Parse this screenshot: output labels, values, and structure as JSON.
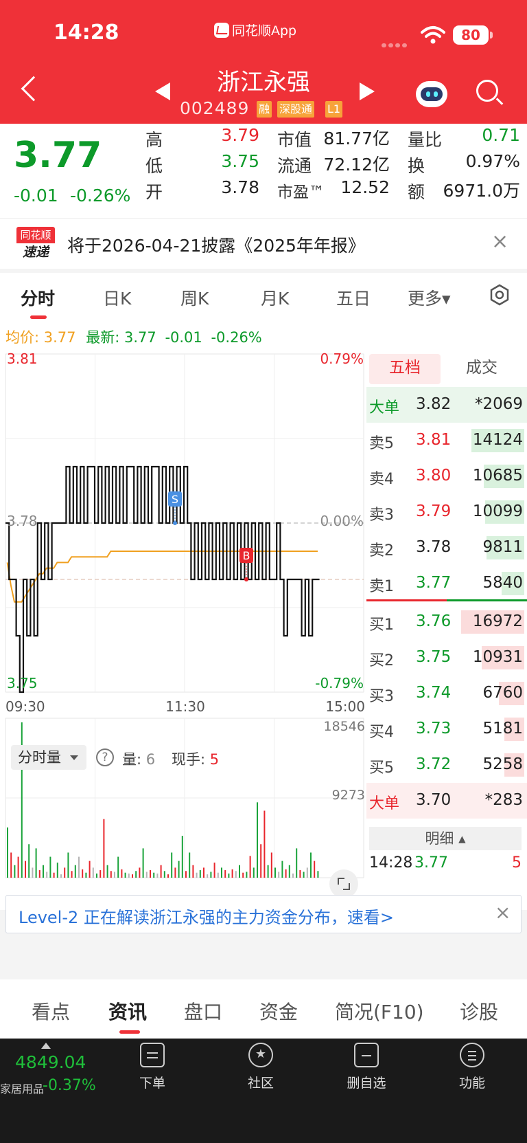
{
  "status_bar": {
    "time": "14:28",
    "app_name": "同花顺App",
    "battery": "80"
  },
  "header": {
    "stock_name": "浙江永强",
    "stock_code": "002489",
    "tags": [
      "融",
      "深股通",
      "L1"
    ]
  },
  "quote": {
    "price": "3.77",
    "change": "-0.01",
    "change_pct": "-0.26%",
    "fields": {
      "high_label": "高",
      "high": "3.79",
      "low_label": "低",
      "low": "3.75",
      "open_label": "开",
      "open": "3.78",
      "mktcap_label": "市值",
      "mktcap": "81.77亿",
      "float_label": "流通",
      "float": "72.12亿",
      "pe_label": "市盈™",
      "pe": "12.52",
      "vr_label": "量比",
      "vr": "0.71",
      "turnover_label": "换",
      "turnover": "0.97%",
      "amount_label": "额",
      "amount": "6971.0万"
    }
  },
  "notice": {
    "logo_top": "同花顺",
    "logo_bottom": "速递",
    "text": "将于2026-04-21披露《2025年年报》",
    "close": "×"
  },
  "chart_tabs": [
    "分时",
    "日K",
    "周K",
    "月K",
    "五日",
    "更多▾"
  ],
  "indicator_line": {
    "avg_label": "均价:",
    "avg": "3.77",
    "latest_label": "最新:",
    "latest": "3.77",
    "change": "-0.01",
    "change_pct": "-0.26%"
  },
  "chart_data": {
    "type": "line",
    "title": "",
    "x_ticks": [
      "09:30",
      "11:30",
      "15:00"
    ],
    "price_axis": {
      "max": "3.81",
      "mid": "3.78",
      "min": "3.75",
      "max_pct": "0.79%",
      "mid_pct": "0.00%",
      "min_pct": "-0.79%"
    },
    "ylim": [
      3.75,
      3.81
    ],
    "series": [
      {
        "name": "",
        "color": "#000000",
        "values": [
          3.78,
          3.77,
          3.77,
          3.76,
          3.75,
          3.77,
          3.76,
          3.77,
          3.76,
          3.78,
          3.77,
          3.78,
          3.77,
          3.78,
          3.78,
          3.78,
          3.78,
          3.79,
          3.78,
          3.79,
          3.78,
          3.79,
          3.78,
          3.79,
          3.79,
          3.78,
          3.79,
          3.78,
          3.79,
          3.78,
          3.79,
          3.78,
          3.79,
          3.78,
          3.79,
          3.79,
          3.78,
          3.79,
          3.78,
          3.79,
          3.78,
          3.79,
          3.79,
          3.78,
          3.79,
          3.78,
          3.79,
          3.78,
          3.79,
          3.78,
          3.79,
          3.78,
          3.77,
          3.78,
          3.77,
          3.78,
          3.77,
          3.78,
          3.77,
          3.78,
          3.77,
          3.78,
          3.77,
          3.78,
          3.77,
          3.78,
          3.77,
          3.78,
          3.77,
          3.78,
          3.77,
          3.78,
          3.77,
          3.78,
          3.77,
          3.77,
          3.78,
          3.77,
          3.76,
          3.77,
          3.77,
          3.77,
          3.77,
          3.76,
          3.77,
          3.76,
          3.77,
          3.77
        ]
      },
      {
        "name": "",
        "color": "#f0a020",
        "values": [
          3.773,
          3.769,
          3.766,
          3.766,
          3.766,
          3.767,
          3.768,
          3.769,
          3.77,
          3.771,
          3.771,
          3.772,
          3.772,
          3.772,
          3.773,
          3.773,
          3.773,
          3.773,
          3.774,
          3.774,
          3.774,
          3.774,
          3.774,
          3.774,
          3.774,
          3.774,
          3.774,
          3.774,
          3.774,
          3.775,
          3.775,
          3.775,
          3.775,
          3.775,
          3.775,
          3.775,
          3.775,
          3.775,
          3.775,
          3.775,
          3.775,
          3.775,
          3.775,
          3.775,
          3.775,
          3.775,
          3.775,
          3.775,
          3.775,
          3.775,
          3.775,
          3.775,
          3.775,
          3.775,
          3.775,
          3.775,
          3.775,
          3.775,
          3.775,
          3.775,
          3.775,
          3.775,
          3.775,
          3.775,
          3.775,
          3.775,
          3.775,
          3.775,
          3.775,
          3.775,
          3.775,
          3.775,
          3.775,
          3.775,
          3.775,
          3.775,
          3.775,
          3.775,
          3.775,
          3.775,
          3.775,
          3.775,
          3.775,
          3.775,
          3.775,
          3.775,
          3.775,
          3.775
        ]
      }
    ],
    "markers": [
      {
        "label": "S",
        "index": 47,
        "value": 3.78,
        "color": "#4a90e2"
      },
      {
        "label": "B",
        "index": 67,
        "value": 3.77,
        "color": "#e8262d"
      }
    ],
    "volume": {
      "ticks": [
        "18546",
        "9273"
      ],
      "ymax": 18546,
      "values": [
        6000,
        3000,
        1500,
        2500,
        18546,
        2000,
        4000,
        1200,
        3500,
        900,
        1500,
        700,
        2500,
        600,
        1800,
        400,
        1200,
        3000,
        800,
        1500,
        2500,
        1000,
        600,
        2000,
        1200,
        500,
        900,
        7000,
        1500,
        800,
        700,
        2500,
        1000,
        600,
        500,
        400,
        800,
        1200,
        3500,
        700,
        900,
        600,
        500,
        1500,
        800,
        400,
        3000,
        1200,
        2000,
        5000,
        800,
        3000,
        1500,
        600,
        900,
        1200,
        400,
        700,
        1800,
        600,
        1200,
        900,
        500,
        1000,
        800,
        1500,
        600,
        700,
        2600,
        1200,
        9000,
        4000,
        8000,
        1500,
        3000,
        1200,
        700,
        2000,
        1000,
        1500,
        500,
        3500,
        900,
        700,
        1200,
        3000,
        2000,
        800
      ],
      "colors": [
        "g",
        "r",
        "g",
        "r",
        "g",
        "r",
        "g",
        "gray",
        "g",
        "r",
        "g",
        "gray",
        "g",
        "r",
        "g",
        "gray",
        "r",
        "g",
        "r",
        "g",
        "gray",
        "r",
        "g",
        "r",
        "gray",
        "g",
        "r",
        "r",
        "g",
        "r",
        "gray",
        "g",
        "r",
        "g",
        "gray",
        "r",
        "g",
        "r",
        "g",
        "gray",
        "r",
        "g",
        "gray",
        "r",
        "g",
        "r",
        "g",
        "r",
        "g",
        "g",
        "r",
        "g",
        "r",
        "gray",
        "g",
        "r",
        "gray",
        "g",
        "r",
        "gray",
        "g",
        "r",
        "g",
        "r",
        "gray",
        "g",
        "r",
        "g",
        "r",
        "g",
        "g",
        "r",
        "r",
        "g",
        "r",
        "g",
        "gray",
        "g",
        "r",
        "g",
        "gray",
        "g",
        "r",
        "g",
        "gray",
        "g",
        "r",
        "g"
      ],
      "dropdown_label": "分时量",
      "vol_label": "量:",
      "vol_value": "6",
      "now_label": "现手:",
      "now_value": "5"
    }
  },
  "order_book": {
    "tabs": [
      "五档",
      "成交"
    ],
    "big_sell": {
      "label": "大单",
      "price": "3.82",
      "vol": "*2069"
    },
    "asks": [
      {
        "label": "卖5",
        "price": "3.81",
        "vol": "14124",
        "ratio": 0.35
      },
      {
        "label": "卖4",
        "price": "3.80",
        "vol": "10685",
        "ratio": 0.27
      },
      {
        "label": "卖3",
        "price": "3.79",
        "vol": "10099",
        "ratio": 0.26
      },
      {
        "label": "卖2",
        "price": "3.78",
        "vol": "9811",
        "ratio": 0.25
      },
      {
        "label": "卖1",
        "price": "3.77",
        "vol": "5840",
        "ratio": 0.15
      }
    ],
    "bids": [
      {
        "label": "买1",
        "price": "3.76",
        "vol": "16972",
        "ratio": 0.42
      },
      {
        "label": "买2",
        "price": "3.75",
        "vol": "10931",
        "ratio": 0.28
      },
      {
        "label": "买3",
        "price": "3.74",
        "vol": "6760",
        "ratio": 0.17
      },
      {
        "label": "买4",
        "price": "3.73",
        "vol": "5181",
        "ratio": 0.13
      },
      {
        "label": "买5",
        "price": "3.72",
        "vol": "5258",
        "ratio": 0.13
      }
    ],
    "big_buy": {
      "label": "大单",
      "price": "3.70",
      "vol": "*283"
    },
    "detail_label": "明细 ▴",
    "last_tick": {
      "time": "14:28",
      "price": "3.77",
      "vol": "5"
    }
  },
  "level2_banner": {
    "text": "Level-2 正在解读浙江永强的主力资金分布，速看>",
    "close": "×"
  },
  "info_tabs": [
    "看点",
    "资讯",
    "盘口",
    "资金",
    "简况(F10)",
    "诊股"
  ],
  "bottom_bar": {
    "index_value": "4849.04",
    "sector": "家居用品",
    "sector_change": "-0.37%",
    "items": [
      "下单",
      "社区",
      "删自选",
      "功能"
    ]
  },
  "colors": {
    "up": "#e8262d",
    "down": "#0d9a2a",
    "avg": "#f0a020",
    "header": "#ef3138"
  }
}
